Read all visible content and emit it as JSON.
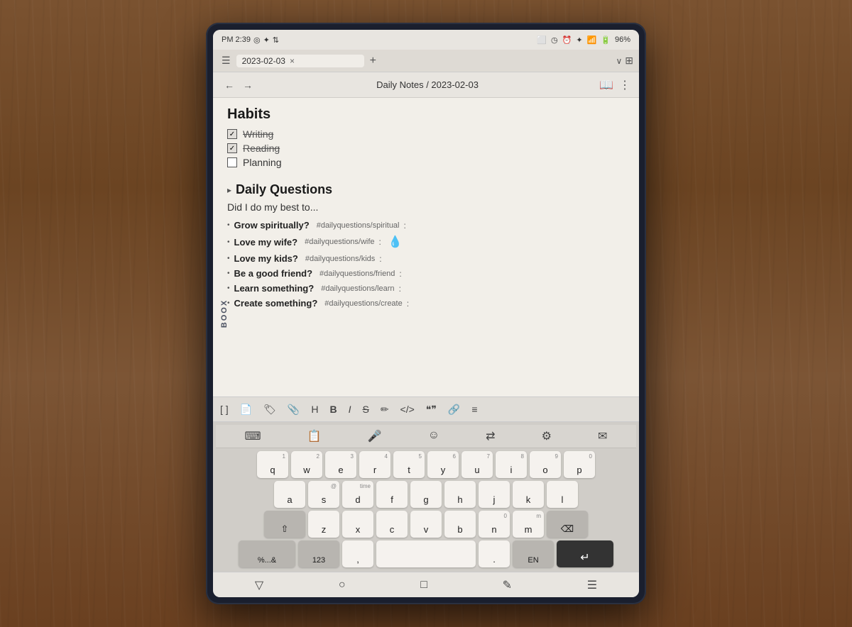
{
  "device": {
    "brand": "BOOX"
  },
  "statusBar": {
    "time": "PM 2:39",
    "battery": "96%",
    "icons": [
      "screenshot",
      "clock",
      "bluetooth",
      "wifi",
      "battery"
    ]
  },
  "tabBar": {
    "currentTab": "2023-02-03",
    "closeLabel": "×",
    "addLabel": "+"
  },
  "navBar": {
    "breadcrumb": "Daily Notes / 2023-02-03"
  },
  "content": {
    "habitsTitle": "Habits",
    "habits": [
      {
        "label": "Writing",
        "checked": true,
        "strikethrough": true
      },
      {
        "label": "Reading",
        "checked": true,
        "strikethrough": true
      },
      {
        "label": "Planning",
        "checked": false,
        "strikethrough": false
      }
    ],
    "dailyQuestionsTitle": "Daily Questions",
    "dailyQuestionsSubtitle": "Did I do my best to...",
    "questions": [
      {
        "text": "Grow spiritually?",
        "tag": "#dailyquestions/spiritual",
        "hasDroplet": false
      },
      {
        "text": "Love my wife?",
        "tag": "#dailyquestions/wife",
        "hasDroplet": true
      },
      {
        "text": "Love my kids?",
        "tag": "#dailyquestions/kids",
        "hasDroplet": false
      },
      {
        "text": "Be a good friend?",
        "tag": "#dailyquestions/friend",
        "hasDroplet": false
      },
      {
        "text": "Learn something?",
        "tag": "#dailyquestions/learn",
        "hasDroplet": false
      },
      {
        "text": "Create something?",
        "tag": "#dailyquestions/create",
        "hasDroplet": false
      }
    ]
  },
  "toolbar": {
    "icons": [
      "[]",
      "📄",
      "🏷",
      "📎",
      "H",
      "B",
      "I",
      "S",
      "✏",
      "</>",
      "\"\"",
      "🔗",
      "≡"
    ]
  },
  "keyboard": {
    "rows": [
      [
        "q",
        "w",
        "e",
        "r",
        "t",
        "y",
        "u",
        "i",
        "o",
        "p"
      ],
      [
        "a",
        "s",
        "d",
        "f",
        "g",
        "h",
        "j",
        "k",
        "l"
      ],
      [
        "z",
        "x",
        "c",
        "v",
        "b",
        "n",
        "m"
      ]
    ],
    "numbers": [
      "1",
      "2",
      "3",
      "4",
      "5",
      "6",
      "7",
      "8",
      "9",
      "0"
    ],
    "specialKeys": {
      "shift": "⇧",
      "backspace": "⌫",
      "symbols": "%...&",
      "numpad": "123",
      "comma": ",",
      "period": ".",
      "lang": "EN",
      "return": "↵"
    }
  },
  "bottomNav": {
    "icons": [
      "▽",
      "○",
      "□",
      "✎",
      "☰"
    ]
  }
}
